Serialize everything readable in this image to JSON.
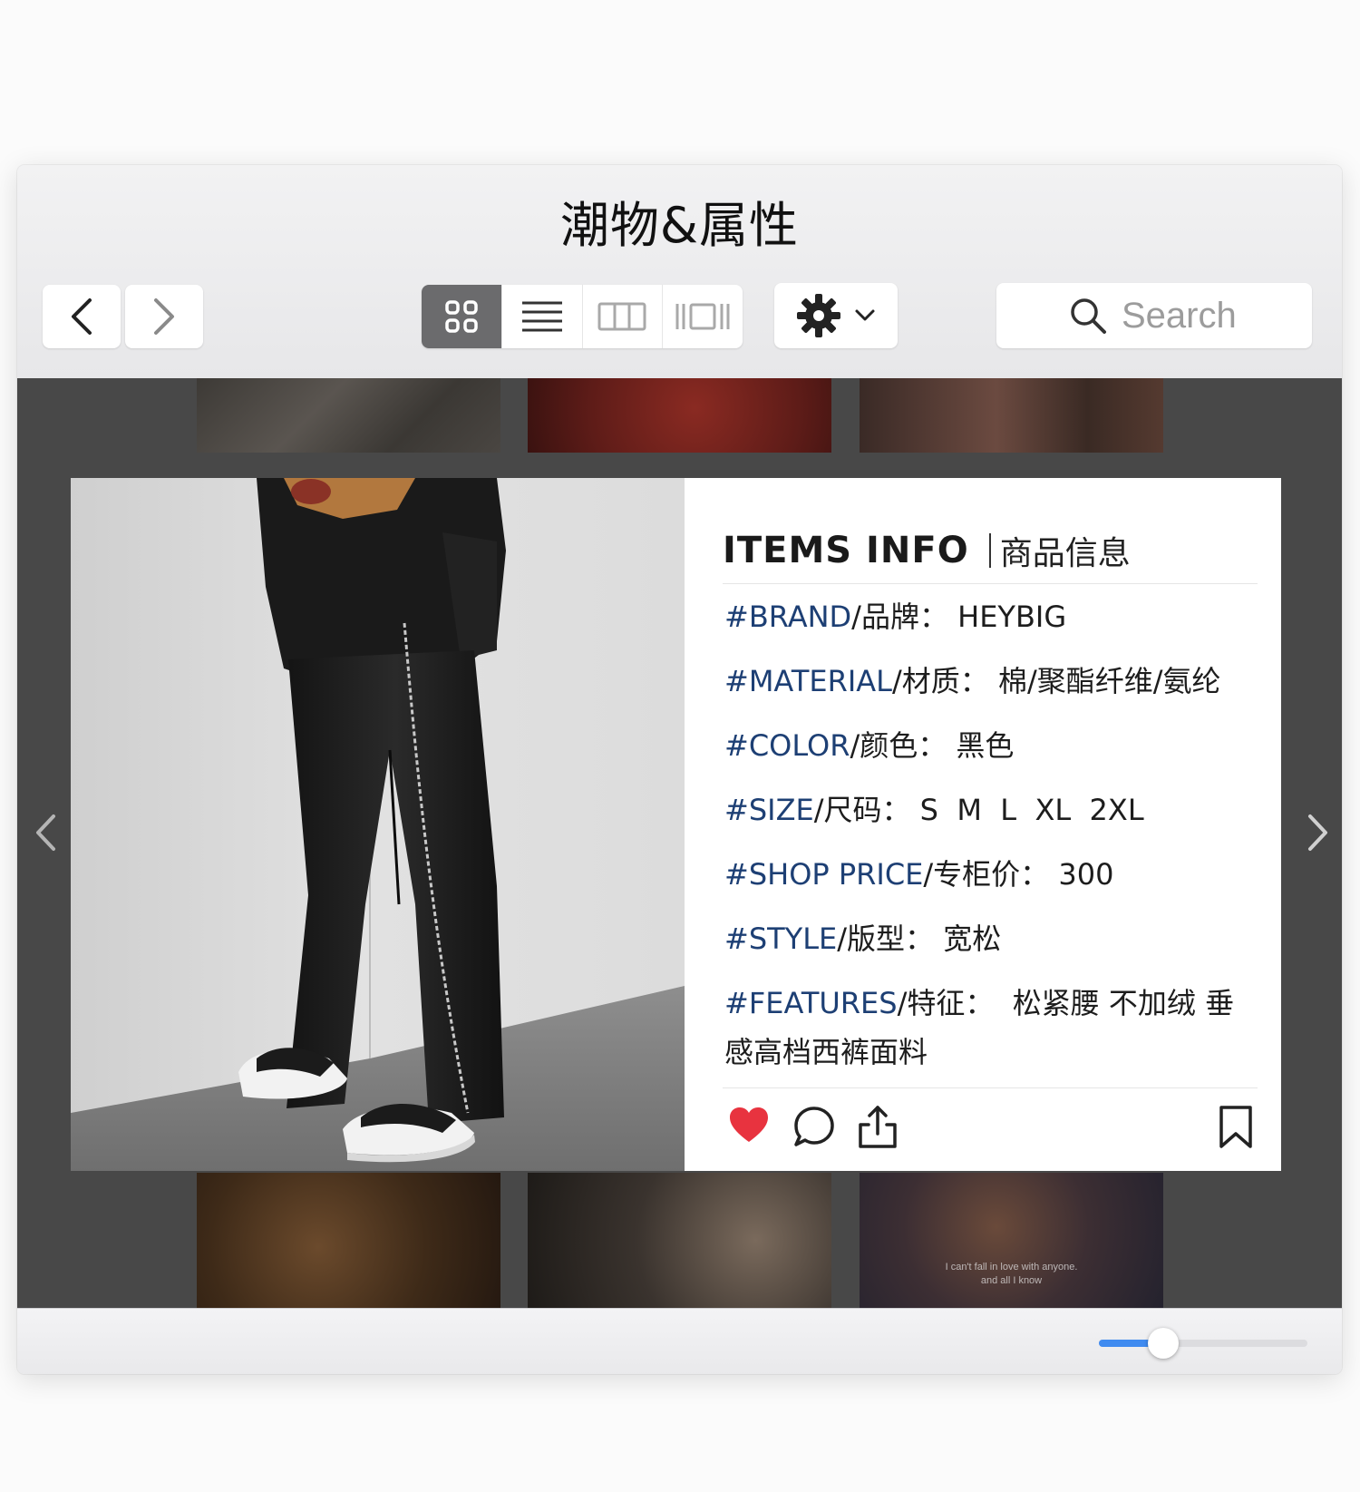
{
  "window": {
    "title": "潮物&属性"
  },
  "toolbar": {
    "back_icon": "chevron-left-icon",
    "forward_icon": "chevron-right-icon",
    "view_modes": [
      {
        "name": "icon-grid-view",
        "active": true
      },
      {
        "name": "list-view",
        "active": false
      },
      {
        "name": "column-view",
        "active": false
      },
      {
        "name": "gallery-view",
        "active": false
      }
    ],
    "action_menu_icon": "gear-icon",
    "search": {
      "placeholder": "Search",
      "value": ""
    }
  },
  "gallery": {
    "bottom_thumb_caption": [
      "I can't fall in love with anyone.",
      "and all I know"
    ]
  },
  "card": {
    "title_en": "ITEMS INFO",
    "title_cn": "商品信息",
    "attributes": [
      {
        "tag": "#BRAND",
        "label": "/品牌：",
        "value": "HEYBIG"
      },
      {
        "tag": "#MATERIAL",
        "label": "/材质：",
        "value": "棉/聚酯纤维/氨纶"
      },
      {
        "tag": "#COLOR",
        "label": "/颜色：",
        "value": "黑色"
      },
      {
        "tag": "#SIZE",
        "label": "/尺码：",
        "value": "S  M  L  XL  2XL"
      },
      {
        "tag": "#SHOP PRICE",
        "label": "/专柜价：",
        "value": "300"
      },
      {
        "tag": "#STYLE",
        "label": "/版型：",
        "value": "宽松"
      },
      {
        "tag": "#FEATURES",
        "label": "/特征：",
        "value": "  松紧腰 不加绒 垂感高档西裤面料"
      }
    ],
    "actions": [
      "heart-icon",
      "comment-icon",
      "share-icon",
      "bookmark-icon"
    ]
  },
  "colors": {
    "accent": "#3f8bf0",
    "heart": "#e8333f",
    "tag_text": "#1d3f74",
    "content_bg": "#484848"
  },
  "zoom_slider": {
    "value_fraction": 0.31
  }
}
